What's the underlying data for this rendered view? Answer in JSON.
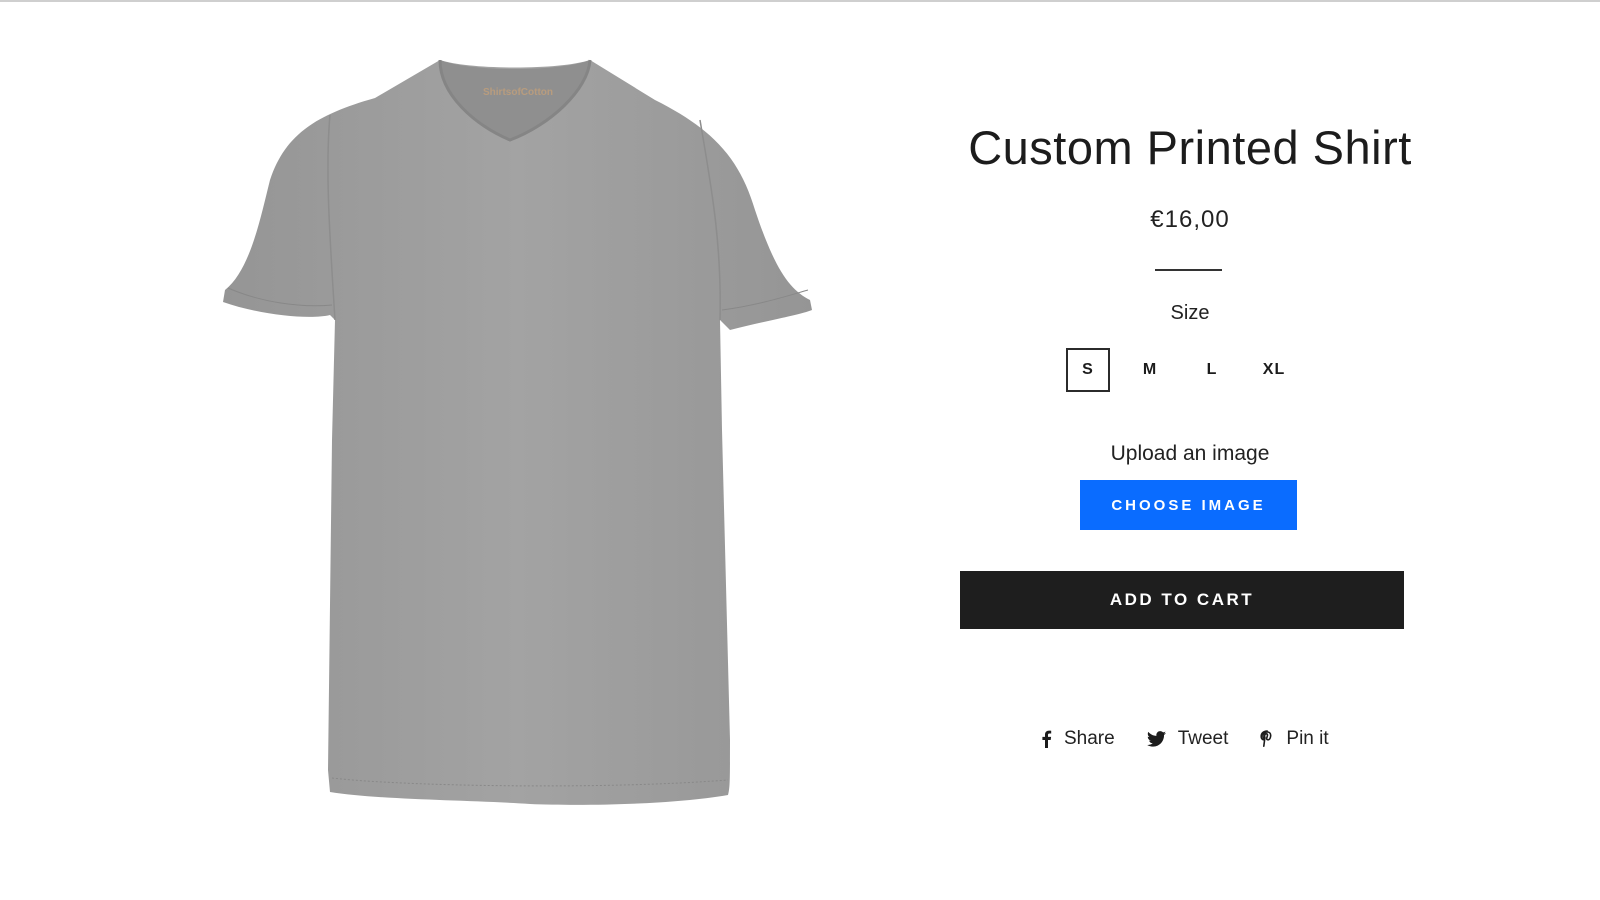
{
  "product": {
    "title": "Custom Printed Shirt",
    "price": "€16,00",
    "image_alt": "Grey v-neck t-shirt",
    "image_label": "ShirtsofCotton",
    "shirt_color": "#9e9e9e"
  },
  "size": {
    "label": "Size",
    "selected": "S",
    "options": [
      "S",
      "M",
      "L",
      "XL"
    ]
  },
  "upload": {
    "label": "Upload an image",
    "button_label": "CHOOSE IMAGE",
    "button_color": "#0a6cff"
  },
  "cart": {
    "button_label": "ADD TO CART",
    "button_color": "#1e1e1e"
  },
  "share": [
    {
      "icon": "facebook-icon",
      "label": "Share"
    },
    {
      "icon": "twitter-icon",
      "label": "Tweet"
    },
    {
      "icon": "pinterest-icon",
      "label": "Pin it"
    }
  ]
}
